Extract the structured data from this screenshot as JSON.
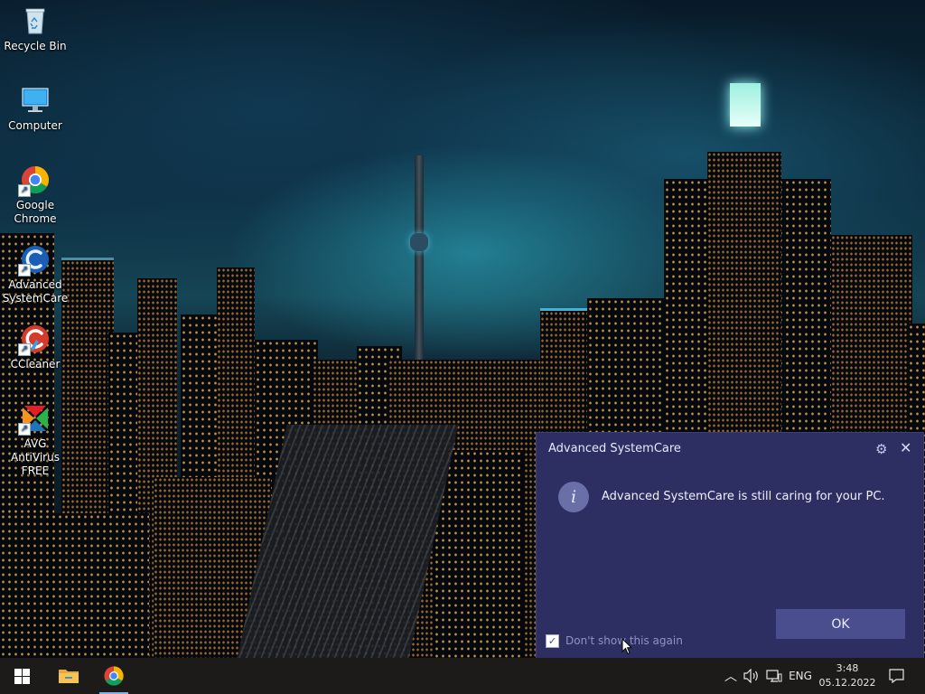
{
  "desktop": {
    "icons": [
      {
        "label": "Recycle Bin",
        "icon": "recycle-bin-icon"
      },
      {
        "label": "Computer",
        "icon": "computer-icon"
      },
      {
        "label": "Google Chrome",
        "icon": "chrome-icon"
      },
      {
        "label": "Advanced SystemCare",
        "icon": "advanced-systemcare-icon"
      },
      {
        "label": "CCleaner",
        "icon": "ccleaner-icon"
      },
      {
        "label": "AVG AntiVirus FREE",
        "icon": "avg-antivirus-icon"
      }
    ]
  },
  "dialog": {
    "title": "Advanced SystemCare",
    "message": "Advanced SystemCare is still caring for your PC.",
    "ok_label": "OK",
    "dont_show_label": "Don't show this again",
    "dont_show_checked": true,
    "info_glyph": "i",
    "background_color": "#2d2f63"
  },
  "taskbar": {
    "pinned": [
      {
        "name": "start-button",
        "icon": "windows-logo-icon"
      },
      {
        "name": "file-explorer",
        "icon": "folder-icon"
      },
      {
        "name": "google-chrome",
        "icon": "chrome-icon"
      }
    ],
    "language": "ENG",
    "time": "3:48",
    "date": "05.12.2022"
  }
}
